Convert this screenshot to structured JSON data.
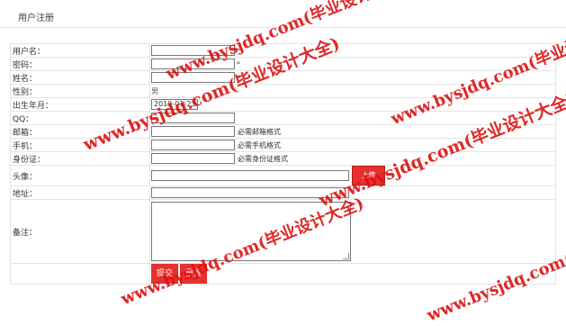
{
  "header": {
    "title": "用户注册"
  },
  "form": {
    "labels": {
      "username": "用户名：",
      "password": "密码：",
      "fullname": "姓名：",
      "gender": "性别：",
      "birthday": "出生年月：",
      "qq": "QQ：",
      "email": "邮箱：",
      "phone": "手机：",
      "idcard": "身份证：",
      "avatar": "头像：",
      "address": "地址：",
      "remark": "备注："
    },
    "required_mark": "*",
    "gender_value": "男",
    "birthday_value": "2019-01-23",
    "notes": {
      "email": "必需邮箱格式",
      "phone": "必需手机格式",
      "idcard": "必需身份证格式"
    },
    "upload_label": "上传",
    "submit_label": "提交",
    "reset_label": "重置"
  },
  "watermarks": [
    "www.bysjdq.com(毕业设计大全)",
    "www.bysjdq.com(毕业设计大全)",
    "www.bysjdq.com(毕业设计大全)",
    "www.bysjdq.com(毕业设计大全)",
    "www.bysjdq.com(毕业设计大全)",
    "www.bysjdq.com(毕业设计大全)"
  ],
  "colors": {
    "accent": "#e8302e",
    "watermark": "#dd1010"
  }
}
